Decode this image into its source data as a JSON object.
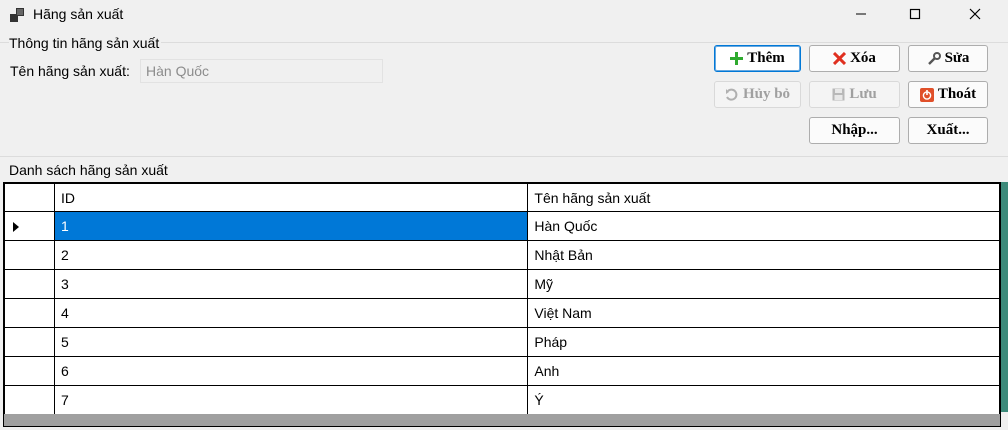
{
  "window": {
    "title": "Hãng sản xuất"
  },
  "info_group": {
    "legend": "Thông tin hãng sản xuất",
    "name_label": "Tên hãng sản xuất:",
    "name_value": "Hàn Quốc"
  },
  "buttons": {
    "add": "Thêm",
    "delete": "Xóa",
    "edit": "Sửa",
    "cancel": "Hủy bỏ",
    "save": "Lưu",
    "exit": "Thoát",
    "import": "Nhập...",
    "export": "Xuất..."
  },
  "list_group": {
    "legend": "Danh sách hãng sản xuất"
  },
  "grid": {
    "columns": [
      "ID",
      "Tên hãng sản xuất"
    ],
    "rows": [
      {
        "id": "1",
        "name": "Hàn Quốc"
      },
      {
        "id": "2",
        "name": "Nhật Bản"
      },
      {
        "id": "3",
        "name": "Mỹ"
      },
      {
        "id": "4",
        "name": "Việt Nam"
      },
      {
        "id": "5",
        "name": "Pháp"
      },
      {
        "id": "6",
        "name": "Anh"
      },
      {
        "id": "7",
        "name": "Ý"
      }
    ],
    "selected_row": 0
  },
  "colors": {
    "accent": "#0078d7",
    "add_icon": "#2eaa2e",
    "delete_icon": "#e03020",
    "exit_icon": "#e0502a"
  },
  "icons": [
    "app-icon",
    "minimize-icon",
    "maximize-icon",
    "close-icon",
    "plus-icon",
    "x-icon",
    "wrench-icon",
    "undo-icon",
    "floppy-icon",
    "power-icon",
    "row-arrow-icon"
  ]
}
